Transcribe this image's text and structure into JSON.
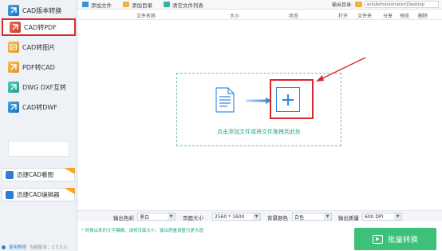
{
  "sidebar": {
    "items": [
      {
        "label": "CAD版本转换",
        "icon": "cad-version-icon"
      },
      {
        "label": "CAD转PDF",
        "icon": "cad-to-pdf-icon"
      },
      {
        "label": "CAD转图片",
        "icon": "cad-to-image-icon"
      },
      {
        "label": "PDF转CAD",
        "icon": "pdf-to-cad-icon"
      },
      {
        "label": "DWG DXF互转",
        "icon": "dwg-dxf-icon"
      },
      {
        "label": "CAD转DWF",
        "icon": "cad-to-dwf-icon"
      }
    ],
    "promos": [
      {
        "label": "迅捷CAD看图"
      },
      {
        "label": "迅捷CAD编辑器"
      }
    ],
    "footer": {
      "link": "使用教程",
      "version": "当前版本：2.7.5.0"
    }
  },
  "toolbar": {
    "add_file": "添加文件",
    "add_folder": "添加目录",
    "clear_list": "清空文件列表",
    "output_label": "输出目录:",
    "output_path": "ers\\Administrator\\Desktop"
  },
  "table_headers": [
    "文件名称",
    "大小",
    "状态",
    "打开",
    "文件夹",
    "分享",
    "预览",
    "删除"
  ],
  "drop": {
    "text": "点击添加文件或将文件拖拽到此处"
  },
  "settings": {
    "color_label": "输出色彩",
    "color_value": "黑白",
    "size_label": "页面大小",
    "size_value": "2560 * 1600",
    "bg_label": "背景颜色",
    "bg_value": "白色",
    "quality_label": "输出质量",
    "quality_value": "600 DPI"
  },
  "note": "* 转换出来的文字模糊，请将页面大小、输出质量调整为更大值",
  "convert_button": "批量转换",
  "colors": {
    "accent_green": "#3cc07a",
    "highlight_red": "#d9262c",
    "blue": "#2f86d8"
  }
}
